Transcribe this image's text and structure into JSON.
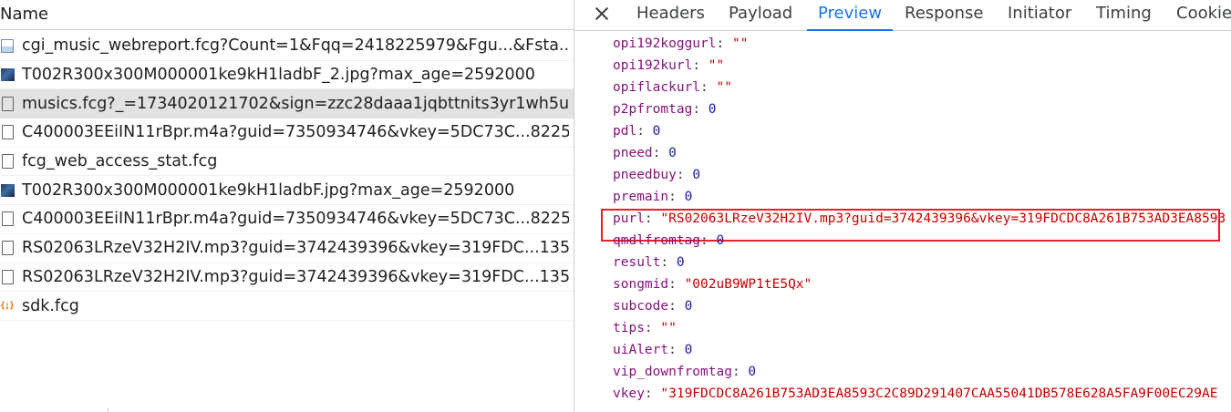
{
  "network_list": {
    "header": "Name",
    "rows": [
      {
        "icon": "image-broken-icon",
        "name": "cgi_music_webreport.fcg?Count=1&Fqq=2418225979&Fgu...&Fsta...",
        "selected": false
      },
      {
        "icon": "image-thumbnail-icon",
        "name": "T002R300x300M000001ke9kH1ladbF_2.jpg?max_age=2592000",
        "selected": false
      },
      {
        "icon": "document-icon",
        "name": "musics.fcg?_=1734020121702&sign=zzc28daaa1jqbttnits3yr1wh5u...",
        "selected": true
      },
      {
        "icon": "document-icon",
        "name": "C400003EEiIN11rBpr.m4a?guid=7350934746&vkey=5DC73C...8225...",
        "selected": false
      },
      {
        "icon": "document-icon",
        "name": "fcg_web_access_stat.fcg",
        "selected": false
      },
      {
        "icon": "image-thumbnail-icon",
        "name": "T002R300x300M000001ke9kH1ladbF.jpg?max_age=2592000",
        "selected": false
      },
      {
        "icon": "document-icon",
        "name": "C400003EEiIN11rBpr.m4a?guid=7350934746&vkey=5DC73C...8225...",
        "selected": false
      },
      {
        "icon": "document-icon",
        "name": "RS02063LRzeV32H2IV.mp3?guid=3742439396&vkey=319FDC...135...",
        "selected": false
      },
      {
        "icon": "document-icon",
        "name": "RS02063LRzeV32H2IV.mp3?guid=3742439396&vkey=319FDC...135...",
        "selected": false
      },
      {
        "icon": "script-icon",
        "name": "sdk.fcg",
        "selected": false
      }
    ]
  },
  "detail_tabs": {
    "close_label": "close",
    "tabs": [
      "Headers",
      "Payload",
      "Preview",
      "Response",
      "Initiator",
      "Timing",
      "Cookies"
    ],
    "active": "Preview"
  },
  "preview": {
    "lines": [
      {
        "key": "opi192koggurl",
        "value": "\"\"",
        "type": "string"
      },
      {
        "key": "opi192kurl",
        "value": "\"\"",
        "type": "string"
      },
      {
        "key": "opiflackurl",
        "value": "\"\"",
        "type": "string"
      },
      {
        "key": "p2pfromtag",
        "value": "0",
        "type": "number"
      },
      {
        "key": "pdl",
        "value": "0",
        "type": "number"
      },
      {
        "key": "pneed",
        "value": "0",
        "type": "number"
      },
      {
        "key": "pneedbuy",
        "value": "0",
        "type": "number"
      },
      {
        "key": "premain",
        "value": "0",
        "type": "number"
      },
      {
        "key": "purl",
        "value": "\"RS02063LRzeV32H2IV.mp3?guid=3742439396&vkey=319FDCDC8A261B753AD3EA8593",
        "type": "string",
        "highlighted": true
      },
      {
        "key": "qmdlfromtag",
        "value": "0",
        "type": "number"
      },
      {
        "key": "result",
        "value": "0",
        "type": "number"
      },
      {
        "key": "songmid",
        "value": "\"002uB9WP1tE5Qx\"",
        "type": "string"
      },
      {
        "key": "subcode",
        "value": "0",
        "type": "number"
      },
      {
        "key": "tips",
        "value": "\"\"",
        "type": "string"
      },
      {
        "key": "uiAlert",
        "value": "0",
        "type": "number"
      },
      {
        "key": "vip_downfromtag",
        "value": "0",
        "type": "number"
      },
      {
        "key": "vkey",
        "value": "\"319FDCDC8A261B753AD3EA8593C2C89D291407CAA55041DB578E628A5FA9F00EC29AE",
        "type": "string"
      }
    ]
  },
  "colors": {
    "accent": "#1a73e8",
    "highlight_box": "#e8202a",
    "key_color": "#881280",
    "string_color": "#c80000",
    "number_color": "#1a1aa6"
  }
}
